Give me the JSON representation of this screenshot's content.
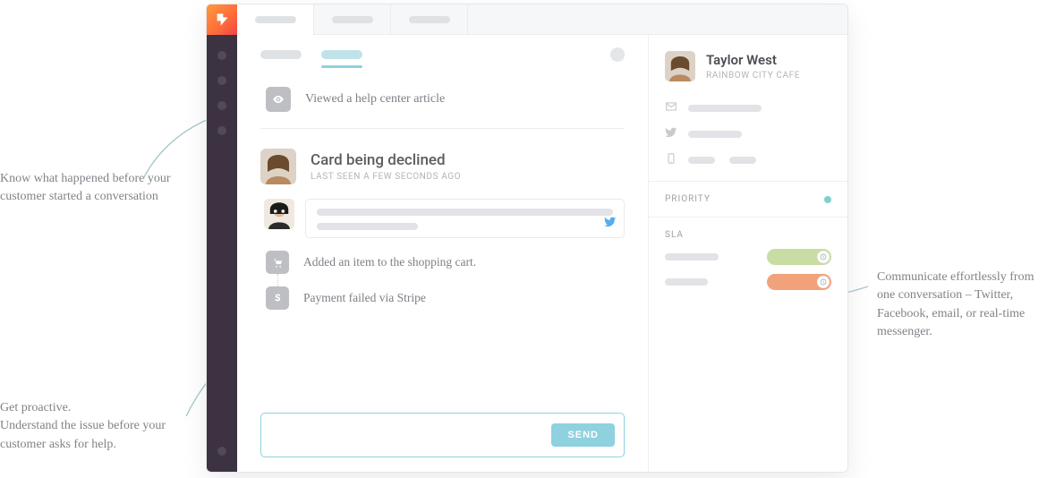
{
  "events": {
    "viewed_article": "Viewed a help center article"
  },
  "conversation": {
    "subject": "Card being declined",
    "last_seen": "LAST SEEN A FEW SECONDS AGO"
  },
  "timeline": {
    "step1": "Added an item to the shopping cart.",
    "step2": "Payment failed via Stripe"
  },
  "composer": {
    "send_label": "SEND"
  },
  "customer": {
    "name": "Taylor West",
    "org": "RAINBOW CITY CAFE"
  },
  "details": {
    "priority_label": "PRIORITY",
    "sla_label": "SLA"
  },
  "annotations": {
    "before": "Know what happened before your customer started a conversation",
    "proactive": "Get proactive.\nUnderstand the issue before your customer asks for help.",
    "communicate": "Communicate effortlessly from one conversation – Twitter, Facebook, email, or real-time messenger."
  }
}
